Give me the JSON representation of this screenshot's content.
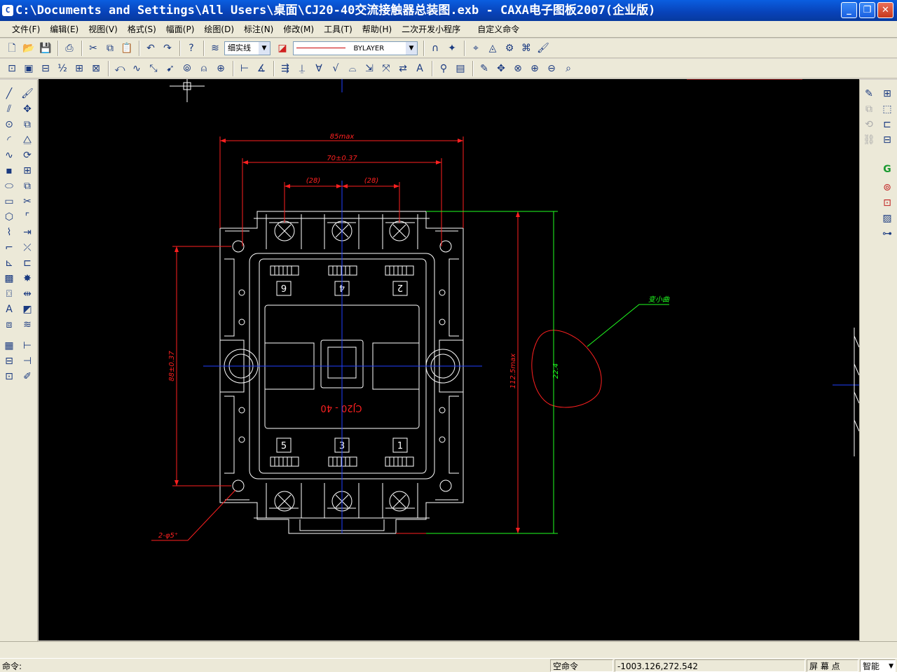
{
  "window": {
    "title": "C:\\Documents and Settings\\All Users\\桌面\\CJ20-40交流接触器总装图.exb - CAXA电子图板2007(企业版)",
    "minimize": "_",
    "maximize": "❐",
    "close": "✕"
  },
  "menu": [
    "文件(F)",
    "编辑(E)",
    "视图(V)",
    "格式(S)",
    "幅面(P)",
    "绘图(D)",
    "标注(N)",
    "修改(M)",
    "工具(T)",
    "帮助(H)",
    "二次开发小程序",
    "自定义命令"
  ],
  "toolbar": {
    "linetype": "细实线",
    "layer_line": "BYLAYER"
  },
  "drawing": {
    "dim_top": "85max",
    "dim_mid": "70±0.37",
    "dim_left_half": "(28)",
    "dim_right_half": "(28)",
    "dim_left_vertical": "88±0.37",
    "dim_height": "112.5max",
    "dim_curve": "22.4",
    "hole_note": "2-φ5⁺",
    "curve_note": "变小曲",
    "model_label": "CJ20 - 40",
    "terminal_top": [
      "6",
      "4",
      "2"
    ],
    "terminal_bottom": [
      "5",
      "3",
      "1"
    ]
  },
  "status": {
    "prompt": "命令:",
    "command": "空命令",
    "coords": "-1003.126,272.542",
    "snap_mode": "屏 幕 点",
    "smart": "智能"
  },
  "colors": {
    "title_bar": "#0842b8",
    "canvas": "#000000",
    "drawing_white": "#ffffff",
    "dimension_red": "#ff2020",
    "centerline_blue": "#2040ff",
    "annotation_green": "#20ff20"
  }
}
